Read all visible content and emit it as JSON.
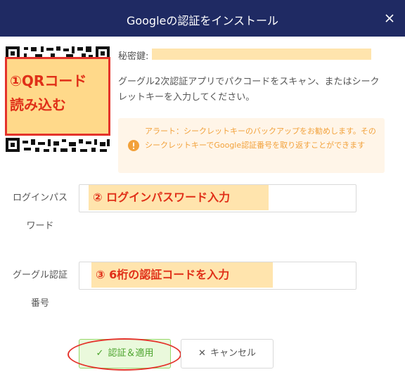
{
  "dialog": {
    "title": "Googleの認証をインストール",
    "close_icon": "close-icon"
  },
  "qr": {
    "annotation": "①QRコード\n読み込む"
  },
  "secret": {
    "label": "秘密鍵:",
    "value": ""
  },
  "description": "グーグル2次認証アプリでパクコードをスキャン、またはシークレットキーを入力してください。",
  "alert": {
    "icon": "warning-icon",
    "message": "アラート：シークレットキーのバックアップをお勧めします。そのシークレットキーでGoogle認証番号を取り返すことができます"
  },
  "fields": {
    "password": {
      "label": "ログインパスワード",
      "annotation": "② ログインパスワード入力"
    },
    "google_code": {
      "label": "グーグル認証番号",
      "annotation": "③ 6桁の認証コードを入力"
    }
  },
  "buttons": {
    "confirm": "認証＆適用",
    "confirm_icon": "check-icon",
    "cancel": "キャンセル",
    "cancel_icon": "x-icon"
  },
  "colors": {
    "header": "#1f2a63",
    "alert_text": "#f2a13a",
    "alert_bg": "#fff5e8",
    "confirm_bg": "#eaf9dc",
    "confirm_text": "#4aa32b",
    "annotation_red": "#e02f18",
    "annotation_bg": "#ffe4ad"
  }
}
